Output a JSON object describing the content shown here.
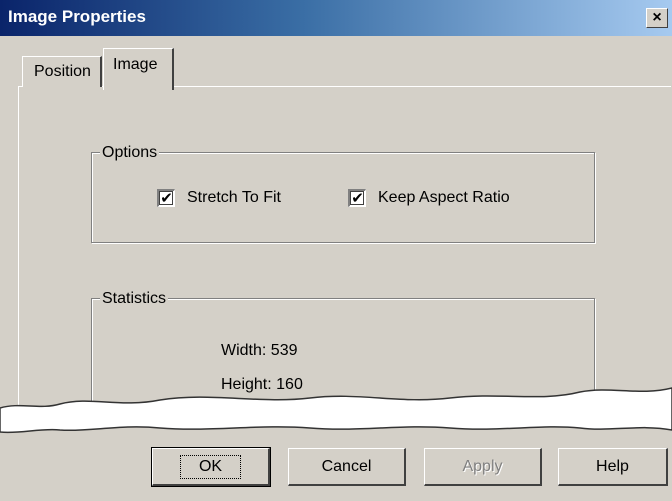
{
  "window": {
    "title": "Image Properties",
    "close_glyph": "×"
  },
  "tabs": [
    {
      "label": "Position",
      "active": false
    },
    {
      "label": "Image",
      "active": true
    }
  ],
  "options": {
    "legend": "Options",
    "stretch_label": "Stretch To Fit",
    "stretch_checked": true,
    "keep_label": "Keep Aspect Ratio",
    "keep_checked": true,
    "check_glyph": "✔"
  },
  "statistics": {
    "legend": "Statistics",
    "width_text": "Width: 539",
    "height_text": "Height: 160"
  },
  "buttons": {
    "ok": "OK",
    "cancel": "Cancel",
    "apply": "Apply",
    "help": "Help"
  },
  "colors": {
    "face": "#d4d0c8",
    "title_start": "#0a246a",
    "title_end": "#a6caf0"
  }
}
